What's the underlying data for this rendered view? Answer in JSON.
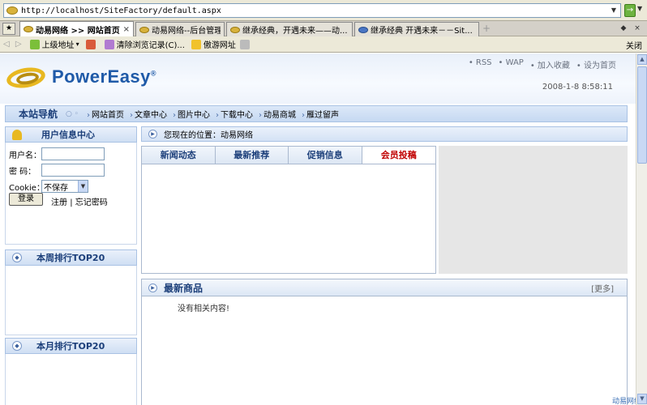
{
  "browser": {
    "url": "http://localhost/SiteFactory/default.aspx",
    "tabs": [
      {
        "label": "动易网络 >> 网站首页",
        "active": true
      },
      {
        "label": "动易网络--后台管理",
        "active": false
      },
      {
        "label": "继承经典，开遇未来——动...",
        "active": false
      },
      {
        "label": "继承经典  开遇未来－－Sit...",
        "active": false
      }
    ],
    "commands": [
      "上级地址",
      "清除浏览记录(C)...",
      "傲游网址"
    ],
    "close_label": "关闭",
    "go_arrow": "→"
  },
  "header": {
    "logo_text": "PowerEasy",
    "logo_reg": "®",
    "top_links": [
      "• RSS",
      "• WAP",
      "• 加入收藏",
      "• 设为首页"
    ],
    "datetime": "2008-1-8 8:58:11"
  },
  "nav": {
    "title": "本站导航",
    "links": [
      "网站首页",
      "文章中心",
      "图片中心",
      "下载中心",
      "动易商城",
      "雁过留声"
    ]
  },
  "user_panel": {
    "title": "用户信息中心",
    "username_label": "用户名：",
    "password_label": "密  码：",
    "cookie_label": "Cookie：",
    "cookie_value": "不保存",
    "login_button": "登录",
    "register_link": "注册",
    "separator": "|",
    "forgot_link": "忘记密码"
  },
  "week_rank": {
    "title": "本周排行TOP20"
  },
  "month_rank": {
    "title": "本月排行TOP20"
  },
  "breadcrumb": {
    "text": "您现在的位置：动易网络"
  },
  "content_tabs": [
    "新闻动态",
    "最新推荐",
    "促销信息",
    "会员投稿"
  ],
  "goods": {
    "title": "最新商品",
    "more": "[更多]",
    "empty": "没有相关内容!"
  },
  "footer_hint": "动易网络"
}
